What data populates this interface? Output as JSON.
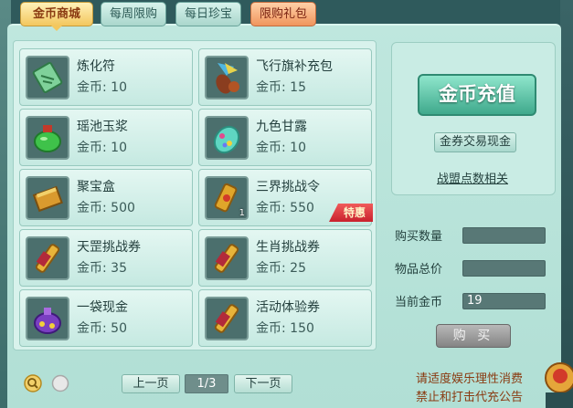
{
  "tabs": [
    {
      "label": "金币商城",
      "active": true
    },
    {
      "label": "每周限购"
    },
    {
      "label": "每日珍宝"
    },
    {
      "label": "限购礼包"
    }
  ],
  "items": [
    {
      "name": "炼化符",
      "price": "金币: 10",
      "icon": "talisman-icon"
    },
    {
      "name": "飞行旗补充包",
      "price": "金币: 15",
      "icon": "flag-pouch-icon"
    },
    {
      "name": "瑶池玉浆",
      "price": "金币: 10",
      "icon": "jade-potion-icon"
    },
    {
      "name": "九色甘露",
      "price": "金币: 10",
      "icon": "nectar-gourd-icon"
    },
    {
      "name": "聚宝盒",
      "price": "金币: 500",
      "icon": "treasure-box-icon"
    },
    {
      "name": "三界挑战令",
      "price": "金币: 550",
      "icon": "challenge-token-icon",
      "qty": "1",
      "badge": "特惠"
    },
    {
      "name": "天罡挑战券",
      "price": "金币: 35",
      "icon": "scroll-icon"
    },
    {
      "name": "生肖挑战券",
      "price": "金币: 25",
      "icon": "scroll-icon"
    },
    {
      "name": "一袋现金",
      "price": "金币: 50",
      "icon": "money-bag-icon"
    },
    {
      "name": "活动体验券",
      "price": "金币: 150",
      "icon": "scroll-icon"
    }
  ],
  "right": {
    "recharge_label": "金币充值",
    "coupon_label": "金券交易现金",
    "alliance_label": "战盟点数相关"
  },
  "fields": {
    "buy_qty_label": "购买数量",
    "buy_qty_value": "",
    "total_label": "物品总价",
    "total_value": "",
    "current_label": "当前金币",
    "current_value": "19"
  },
  "buy_label": "购 买",
  "pager": {
    "prev_label": "上一页",
    "page": "1/3",
    "next_label": "下一页"
  },
  "notice": {
    "line1": "请适度娱乐理性消费",
    "line2": "禁止和打击代充公告"
  },
  "colors": {
    "panel_bg": "#b1dfd5",
    "active_tab": "#f3c75e",
    "accent_green": "#3fa98c",
    "notice_text": "#8a3b12"
  }
}
